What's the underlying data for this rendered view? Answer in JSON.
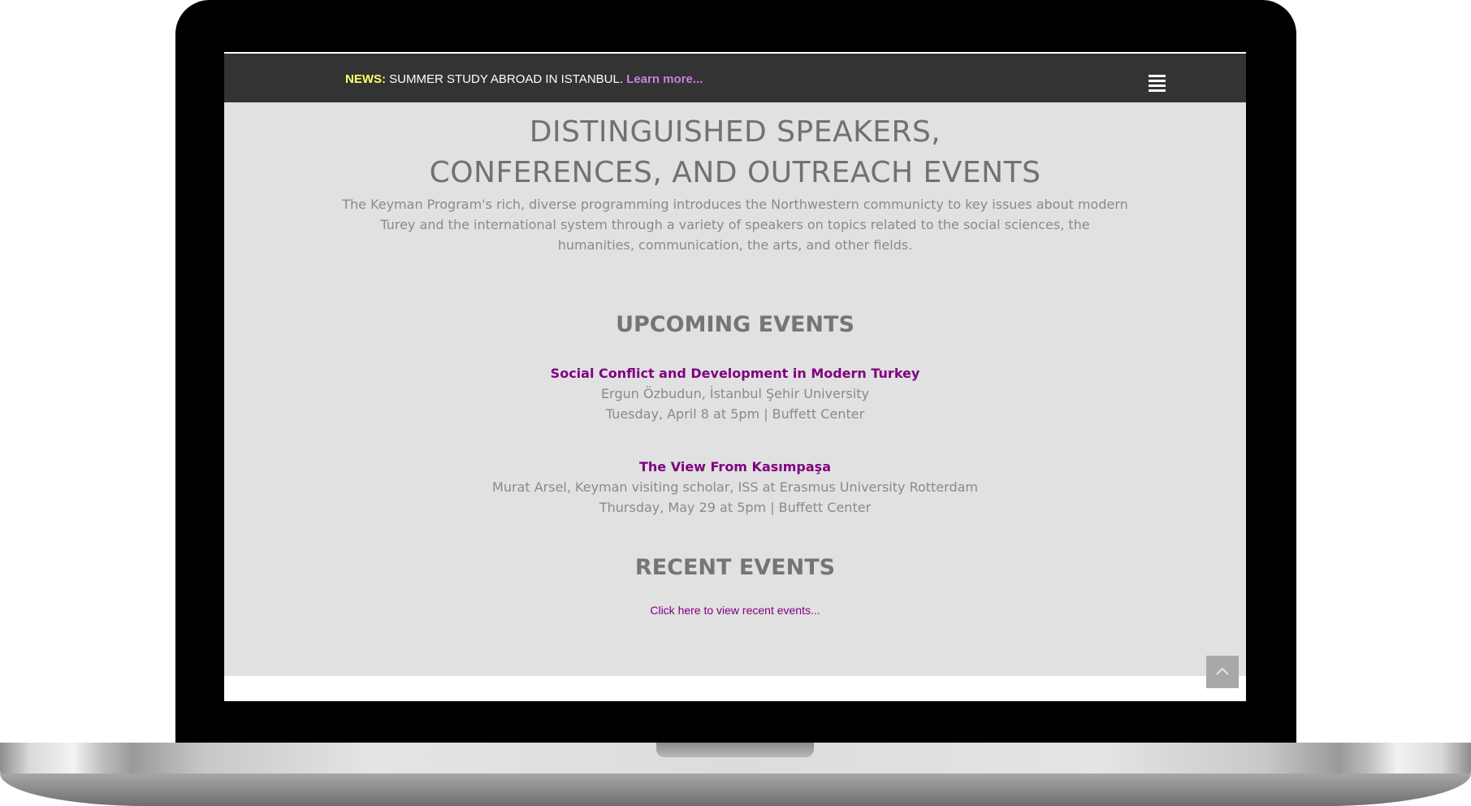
{
  "news": {
    "label": "NEWS:",
    "text": " SUMMER STUDY ABROAD IN ISTANBUL. ",
    "link": "Learn more..."
  },
  "menu_icon": "hamburger-menu-icon",
  "page_title": {
    "line1": "DISTINGUISHED SPEAKERS,",
    "line2": "CONFERENCES, AND OUTREACH EVENTS"
  },
  "intro": "The Keyman Program's rich, diverse programming introduces the Northwestern communicty to key issues about modern Turey and the international system through a variety of speakers on topics related to the social sciences, the humanities, communication, the arts, and other fields.",
  "upcoming": {
    "heading": "UPCOMING EVENTS",
    "events": [
      {
        "title": "Social Conflict and Development in Modern Turkey",
        "speaker": "Ergun Özbudun, İstanbul Şehir University",
        "when": "Tuesday, April 8 at 5pm | Buffett Center"
      },
      {
        "title": "The View From Kasımpaşa",
        "speaker": "Murat Arsel, Keyman visiting scholar, ISS at Erasmus University Rotterdam",
        "when": "Thursday, May 29 at 5pm | Buffett Center"
      }
    ]
  },
  "recent": {
    "heading": "RECENT EVENTS",
    "link": "Click here to view recent events..."
  },
  "scroll_top_icon": "chevron-up-icon",
  "colors": {
    "news_bar": "#333333",
    "news_label": "#ffff66",
    "news_link": "#c97fe0",
    "content_bg": "#e1e1e1",
    "event_title": "#800080",
    "scroll_button": "#a8a8a8"
  }
}
